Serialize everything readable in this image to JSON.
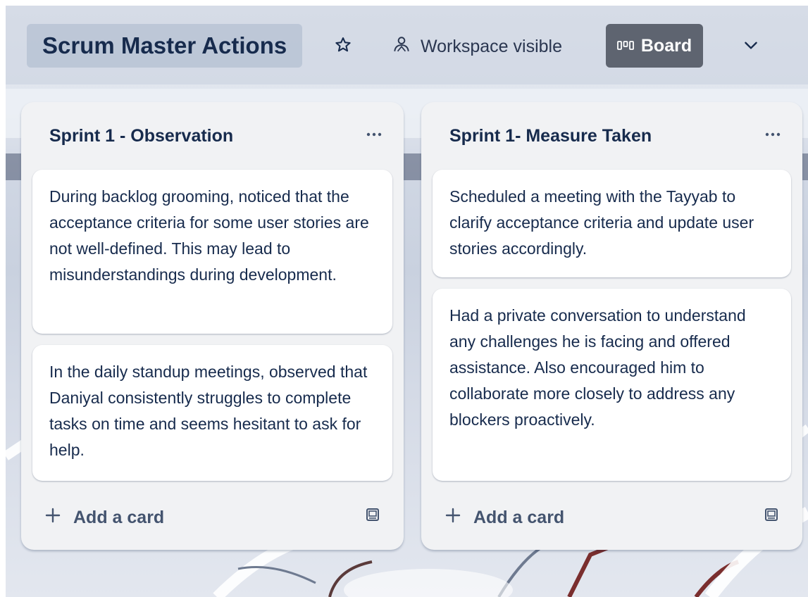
{
  "header": {
    "board_title": "Scrum Master Actions",
    "star_icon": "star-icon",
    "visibility_icon": "workspace-people-icon",
    "visibility_label": "Workspace visible",
    "view_icon": "board-columns-icon",
    "view_label": "Board",
    "dropdown_icon": "chevron-down-icon"
  },
  "lists": [
    {
      "title": "Sprint 1 - Observation",
      "menu_icon": "more-dots-icon",
      "cards": [
        "During backlog grooming, noticed that the acceptance criteria for some user stories are not well-defined. This may lead to misunderstandings during development.",
        "In the daily standup meetings, observed that Daniyal consistently struggles to complete tasks on time and seems hesitant to ask for help."
      ],
      "add_card_label": "Add a card",
      "template_icon": "card-template-icon"
    },
    {
      "title": "Sprint 1- Measure Taken",
      "menu_icon": "more-dots-icon",
      "cards": [
        "Scheduled a meeting with the Tayyab to clarify acceptance criteria and update user stories accordingly.",
        "Had a private conversation to understand any challenges he is facing and offered assistance. Also encouraged him to collaborate more closely to address any blockers proactively."
      ],
      "add_card_label": "Add a card",
      "template_icon": "card-template-icon"
    }
  ]
}
